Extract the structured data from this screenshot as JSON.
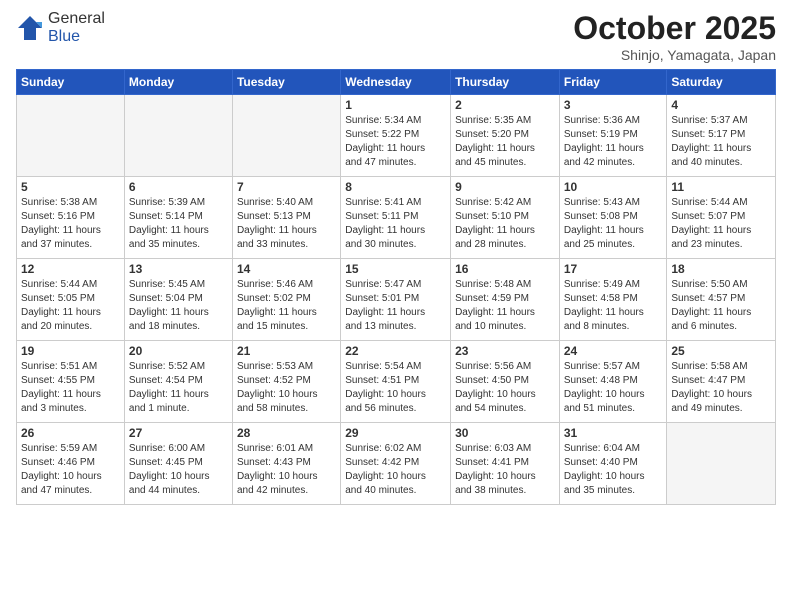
{
  "header": {
    "logo_general": "General",
    "logo_blue": "Blue",
    "month_title": "October 2025",
    "subtitle": "Shinjo, Yamagata, Japan"
  },
  "weekdays": [
    "Sunday",
    "Monday",
    "Tuesday",
    "Wednesday",
    "Thursday",
    "Friday",
    "Saturday"
  ],
  "weeks": [
    [
      {
        "day": "",
        "info": ""
      },
      {
        "day": "",
        "info": ""
      },
      {
        "day": "",
        "info": ""
      },
      {
        "day": "1",
        "info": "Sunrise: 5:34 AM\nSunset: 5:22 PM\nDaylight: 11 hours\nand 47 minutes."
      },
      {
        "day": "2",
        "info": "Sunrise: 5:35 AM\nSunset: 5:20 PM\nDaylight: 11 hours\nand 45 minutes."
      },
      {
        "day": "3",
        "info": "Sunrise: 5:36 AM\nSunset: 5:19 PM\nDaylight: 11 hours\nand 42 minutes."
      },
      {
        "day": "4",
        "info": "Sunrise: 5:37 AM\nSunset: 5:17 PM\nDaylight: 11 hours\nand 40 minutes."
      }
    ],
    [
      {
        "day": "5",
        "info": "Sunrise: 5:38 AM\nSunset: 5:16 PM\nDaylight: 11 hours\nand 37 minutes."
      },
      {
        "day": "6",
        "info": "Sunrise: 5:39 AM\nSunset: 5:14 PM\nDaylight: 11 hours\nand 35 minutes."
      },
      {
        "day": "7",
        "info": "Sunrise: 5:40 AM\nSunset: 5:13 PM\nDaylight: 11 hours\nand 33 minutes."
      },
      {
        "day": "8",
        "info": "Sunrise: 5:41 AM\nSunset: 5:11 PM\nDaylight: 11 hours\nand 30 minutes."
      },
      {
        "day": "9",
        "info": "Sunrise: 5:42 AM\nSunset: 5:10 PM\nDaylight: 11 hours\nand 28 minutes."
      },
      {
        "day": "10",
        "info": "Sunrise: 5:43 AM\nSunset: 5:08 PM\nDaylight: 11 hours\nand 25 minutes."
      },
      {
        "day": "11",
        "info": "Sunrise: 5:44 AM\nSunset: 5:07 PM\nDaylight: 11 hours\nand 23 minutes."
      }
    ],
    [
      {
        "day": "12",
        "info": "Sunrise: 5:44 AM\nSunset: 5:05 PM\nDaylight: 11 hours\nand 20 minutes."
      },
      {
        "day": "13",
        "info": "Sunrise: 5:45 AM\nSunset: 5:04 PM\nDaylight: 11 hours\nand 18 minutes."
      },
      {
        "day": "14",
        "info": "Sunrise: 5:46 AM\nSunset: 5:02 PM\nDaylight: 11 hours\nand 15 minutes."
      },
      {
        "day": "15",
        "info": "Sunrise: 5:47 AM\nSunset: 5:01 PM\nDaylight: 11 hours\nand 13 minutes."
      },
      {
        "day": "16",
        "info": "Sunrise: 5:48 AM\nSunset: 4:59 PM\nDaylight: 11 hours\nand 10 minutes."
      },
      {
        "day": "17",
        "info": "Sunrise: 5:49 AM\nSunset: 4:58 PM\nDaylight: 11 hours\nand 8 minutes."
      },
      {
        "day": "18",
        "info": "Sunrise: 5:50 AM\nSunset: 4:57 PM\nDaylight: 11 hours\nand 6 minutes."
      }
    ],
    [
      {
        "day": "19",
        "info": "Sunrise: 5:51 AM\nSunset: 4:55 PM\nDaylight: 11 hours\nand 3 minutes."
      },
      {
        "day": "20",
        "info": "Sunrise: 5:52 AM\nSunset: 4:54 PM\nDaylight: 11 hours\nand 1 minute."
      },
      {
        "day": "21",
        "info": "Sunrise: 5:53 AM\nSunset: 4:52 PM\nDaylight: 10 hours\nand 58 minutes."
      },
      {
        "day": "22",
        "info": "Sunrise: 5:54 AM\nSunset: 4:51 PM\nDaylight: 10 hours\nand 56 minutes."
      },
      {
        "day": "23",
        "info": "Sunrise: 5:56 AM\nSunset: 4:50 PM\nDaylight: 10 hours\nand 54 minutes."
      },
      {
        "day": "24",
        "info": "Sunrise: 5:57 AM\nSunset: 4:48 PM\nDaylight: 10 hours\nand 51 minutes."
      },
      {
        "day": "25",
        "info": "Sunrise: 5:58 AM\nSunset: 4:47 PM\nDaylight: 10 hours\nand 49 minutes."
      }
    ],
    [
      {
        "day": "26",
        "info": "Sunrise: 5:59 AM\nSunset: 4:46 PM\nDaylight: 10 hours\nand 47 minutes."
      },
      {
        "day": "27",
        "info": "Sunrise: 6:00 AM\nSunset: 4:45 PM\nDaylight: 10 hours\nand 44 minutes."
      },
      {
        "day": "28",
        "info": "Sunrise: 6:01 AM\nSunset: 4:43 PM\nDaylight: 10 hours\nand 42 minutes."
      },
      {
        "day": "29",
        "info": "Sunrise: 6:02 AM\nSunset: 4:42 PM\nDaylight: 10 hours\nand 40 minutes."
      },
      {
        "day": "30",
        "info": "Sunrise: 6:03 AM\nSunset: 4:41 PM\nDaylight: 10 hours\nand 38 minutes."
      },
      {
        "day": "31",
        "info": "Sunrise: 6:04 AM\nSunset: 4:40 PM\nDaylight: 10 hours\nand 35 minutes."
      },
      {
        "day": "",
        "info": ""
      }
    ]
  ]
}
